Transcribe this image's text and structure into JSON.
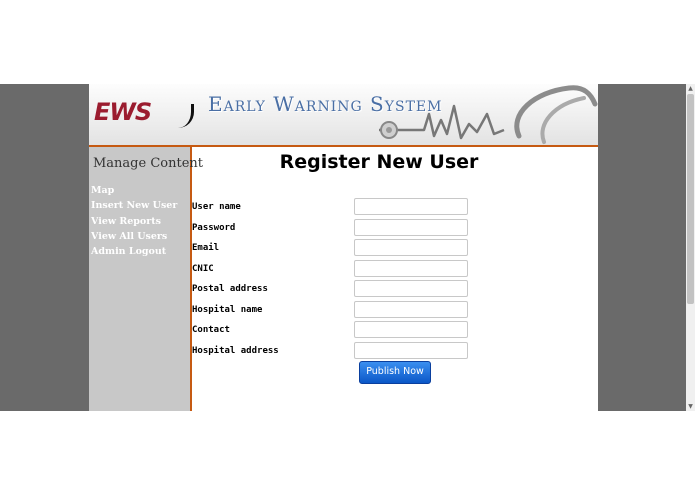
{
  "banner": {
    "logo_text": "EWS",
    "title": "Early Warning System"
  },
  "sidebar": {
    "title": "Manage Content",
    "items": [
      {
        "label": "Map"
      },
      {
        "label": "Insert New User"
      },
      {
        "label": "View Reports"
      },
      {
        "label": "View All Users"
      },
      {
        "label": "Admin Logout"
      }
    ]
  },
  "form": {
    "title": "Register New User",
    "fields": [
      {
        "label": "User name",
        "value": ""
      },
      {
        "label": "Password",
        "value": ""
      },
      {
        "label": "Email",
        "value": ""
      },
      {
        "label": "CNIC",
        "value": ""
      },
      {
        "label": "Postal address",
        "value": ""
      },
      {
        "label": "Hospital name",
        "value": ""
      },
      {
        "label": "Contact",
        "value": ""
      },
      {
        "label": "Hospital address",
        "value": ""
      }
    ],
    "submit_label": "Publish Now"
  },
  "colors": {
    "accent": "#c65a12",
    "logo": "#9b1c2f",
    "title": "#4a6fa5",
    "button": "#0b57c7"
  }
}
